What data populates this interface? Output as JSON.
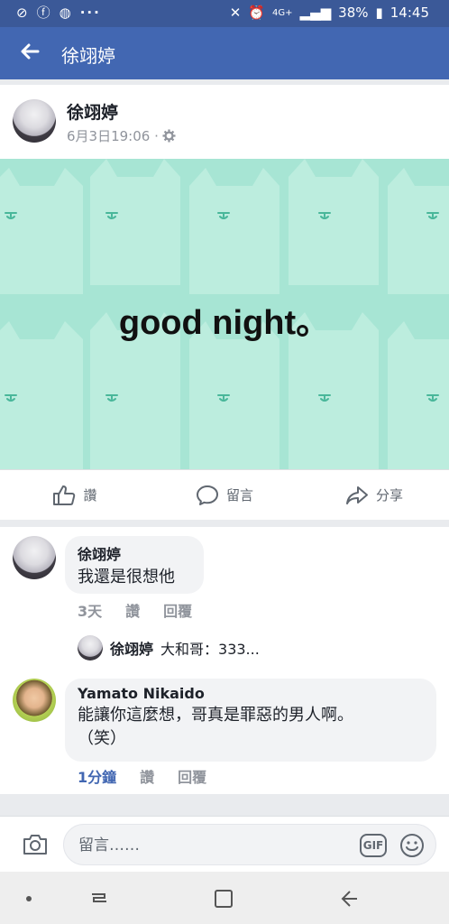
{
  "status_bar": {
    "battery": "38%",
    "time": "14:45",
    "network": "4G+",
    "more": "···"
  },
  "app_bar": {
    "title": "徐翊婷"
  },
  "post": {
    "author": "徐翊婷",
    "timestamp": "6月3日19:06 ·",
    "image_text": "good night。",
    "image_bg": "#a7e5d4",
    "actions": [
      {
        "label": "讚",
        "icon": "like-icon"
      },
      {
        "label": "留言",
        "icon": "comment-icon"
      },
      {
        "label": "分享",
        "icon": "share-icon"
      }
    ]
  },
  "comments": [
    {
      "author": "徐翊婷",
      "text": "我還是很想他",
      "time": "3天",
      "like": "讚",
      "reply": "回覆"
    },
    {
      "author": "Yamato Nikaido",
      "text_line1": "能讓你這麼想，哥真是罪惡的男人啊。",
      "text_line2": "（笑）",
      "time": "1分鐘",
      "like": "讚",
      "reply": "回覆"
    }
  ],
  "reply_preview": {
    "author": "徐翊婷",
    "text": "大和哥：333..."
  },
  "comment_input": {
    "placeholder": "留言……",
    "gif_label": "GIF"
  },
  "colors": {
    "facebook_blue": "#4267b2",
    "status_bar": "#3b5998",
    "link_blue": "#4267b2"
  }
}
